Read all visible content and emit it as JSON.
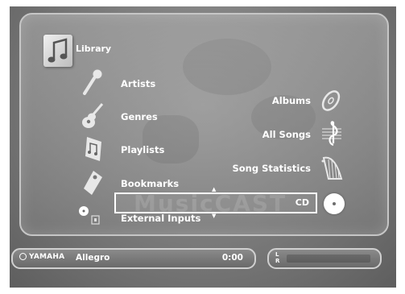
{
  "header": {
    "title": "Library"
  },
  "menu_left": [
    {
      "label": "Artists",
      "icon": "microphone-icon"
    },
    {
      "label": "Genres",
      "icon": "guitar-icon"
    },
    {
      "label": "Playlists",
      "icon": "notes-icon"
    },
    {
      "label": "Bookmarks",
      "icon": "bookmark-icon"
    },
    {
      "label": "External Inputs",
      "icon": "input-disc-icon"
    }
  ],
  "menu_right": [
    {
      "label": "Albums",
      "icon": "disc-icon"
    },
    {
      "label": "All Songs",
      "icon": "treble-clef-icon"
    },
    {
      "label": "Song Statistics",
      "icon": "harp-icon"
    }
  ],
  "selected_source": {
    "label": "CD",
    "icon": "cd-icon"
  },
  "watermark": "MusicCAST",
  "status_bar": {
    "brand": "YAMAHA",
    "track": "Allegro",
    "time": "0:00"
  },
  "level_meter": {
    "channels": "L R",
    "level": 0
  }
}
